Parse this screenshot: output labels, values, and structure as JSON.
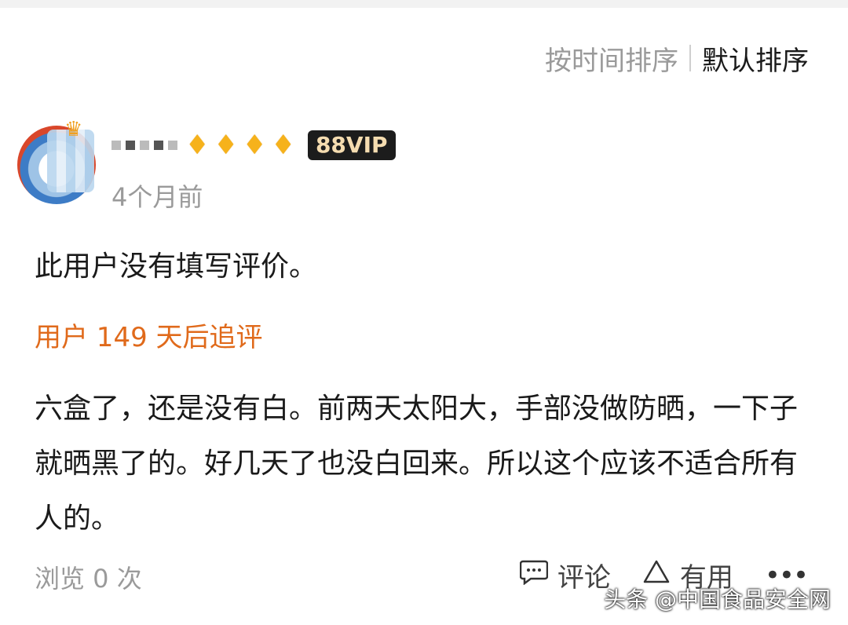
{
  "sort": {
    "by_time": "按时间排序",
    "default": "默认排序"
  },
  "review": {
    "time_ago": "4个月前",
    "vip_badge": "88VIP",
    "gem_count": 4,
    "text": "此用户没有填写评价。",
    "followup_title": "用户 149 天后追评",
    "followup_text": "六盒了，还是没有白。前两天太阳大，手部没做防晒，一下子就晒黑了的。好几天了也没白回来。所以这个应该不适合所有人的。"
  },
  "footer": {
    "views": "浏览 0 次",
    "comment_label": "评论",
    "helpful_label": "有用"
  },
  "watermark": "头条 @中国食品安全网",
  "colors": {
    "accent_orange": "#e06a1b",
    "gem_gold": "#f6b21b",
    "vip_bg": "#1c1c1c"
  },
  "icons": [
    "comment-icon",
    "thumb-triangle-icon",
    "more-dots-icon",
    "gem-icon",
    "crown-icon"
  ]
}
